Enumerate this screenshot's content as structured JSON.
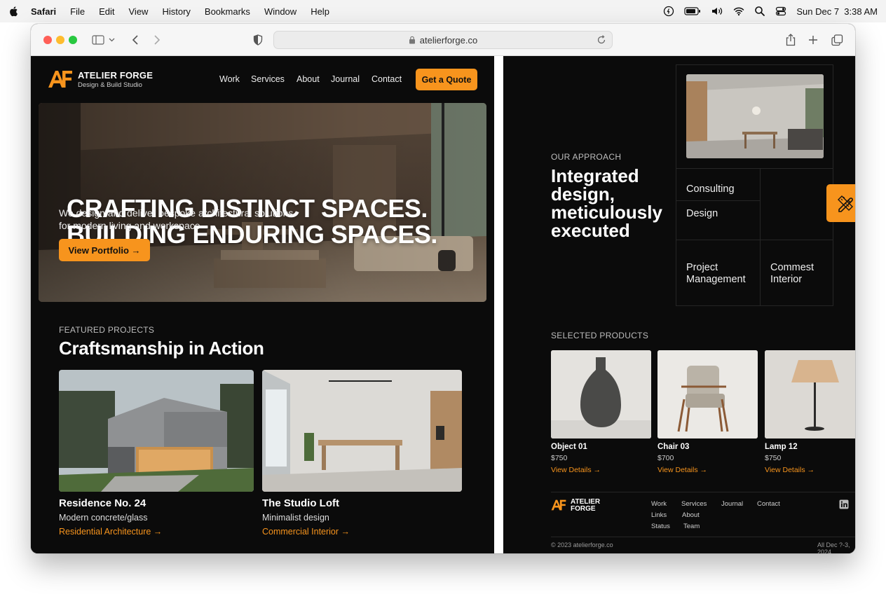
{
  "menubar": {
    "app": "Safari",
    "items": [
      "File",
      "Edit",
      "View",
      "History",
      "Bookmarks",
      "Window",
      "Help"
    ],
    "clock": "Sun Dec 7  3:38 AM"
  },
  "browser": {
    "url": "atelierforge.co"
  },
  "site": {
    "brand": "ATELIER FORGE",
    "tagline": "Design & Build Studio",
    "nav": [
      "Work",
      "Services",
      "About",
      "Journal",
      "Contact"
    ],
    "cta": "Get a Quote",
    "accent": "#f7941d"
  },
  "hero": {
    "line1": "CRAFTING DISTINCT SPACES.",
    "line2": "BUILDING ENDURING SPACES.",
    "sub1": "We design and deliver bespoke architectural solutions",
    "sub2": "for modern living and workspace",
    "button": "View Portfolio →"
  },
  "featured": {
    "eyebrow": "FEATURED PROJECTS",
    "title": "Craftsmanship in Action",
    "projects": [
      {
        "title": "Residence No. 24",
        "subtitle": "Modern concrete/glass",
        "link": "Residential Architecture →"
      },
      {
        "title": "The Studio Loft",
        "subtitle": "Minimalist design",
        "link": "Commercial Interior →"
      }
    ]
  },
  "approach": {
    "eyebrow": "OUR APPROACH",
    "title": "Integrated design, meticulously executed",
    "services": [
      "Consulting",
      "Design",
      "Project Management",
      "Commest Interior"
    ]
  },
  "products": {
    "eyebrow": "SELECTED PRODUCTS",
    "items": [
      {
        "name": "Object 01",
        "price": "$750",
        "link": "View Details →"
      },
      {
        "name": "Chair 03",
        "price": "$700",
        "link": "View Details →"
      },
      {
        "name": "Lamp 12",
        "price": "$750",
        "link": "View Details →"
      }
    ]
  },
  "footer": {
    "brand_line1": "ATELIER",
    "brand_line2": "FORGE",
    "links": [
      "Work",
      "Services",
      "Journal",
      "Contact",
      "Links",
      "About",
      "Status",
      "Team"
    ],
    "copyright": "© 2023 atelierforge.co",
    "date": "All Dec ?-3, 2024"
  }
}
